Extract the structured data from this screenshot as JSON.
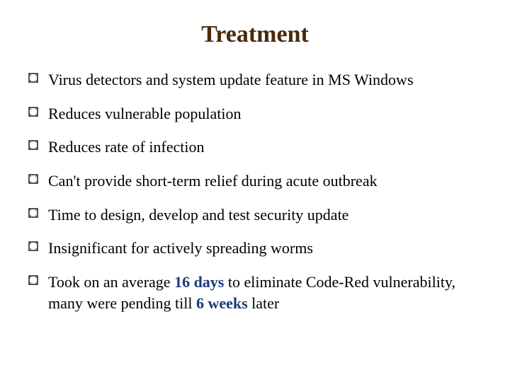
{
  "title": "Treatment",
  "bullets": [
    {
      "text": "Virus detectors and system update feature in MS Windows"
    },
    {
      "text": "Reduces vulnerable population"
    },
    {
      "text": "Reduces rate of infection"
    },
    {
      "text": "Can't provide short-term relief during acute outbreak"
    },
    {
      "text": "Time to design, develop and test security update"
    },
    {
      "text": "Insignificant for actively spreading worms"
    }
  ],
  "last_bullet": {
    "part1": "Took on an average ",
    "hl1": "16 days",
    "part2": " to eliminate Code-Red vulnerability, many were pending till ",
    "hl2": "6 weeks",
    "part3": " later"
  },
  "colors": {
    "title": "#4a2a0a",
    "highlight": "#1b3a7a",
    "bullet_stroke": "#2a2a2a"
  }
}
